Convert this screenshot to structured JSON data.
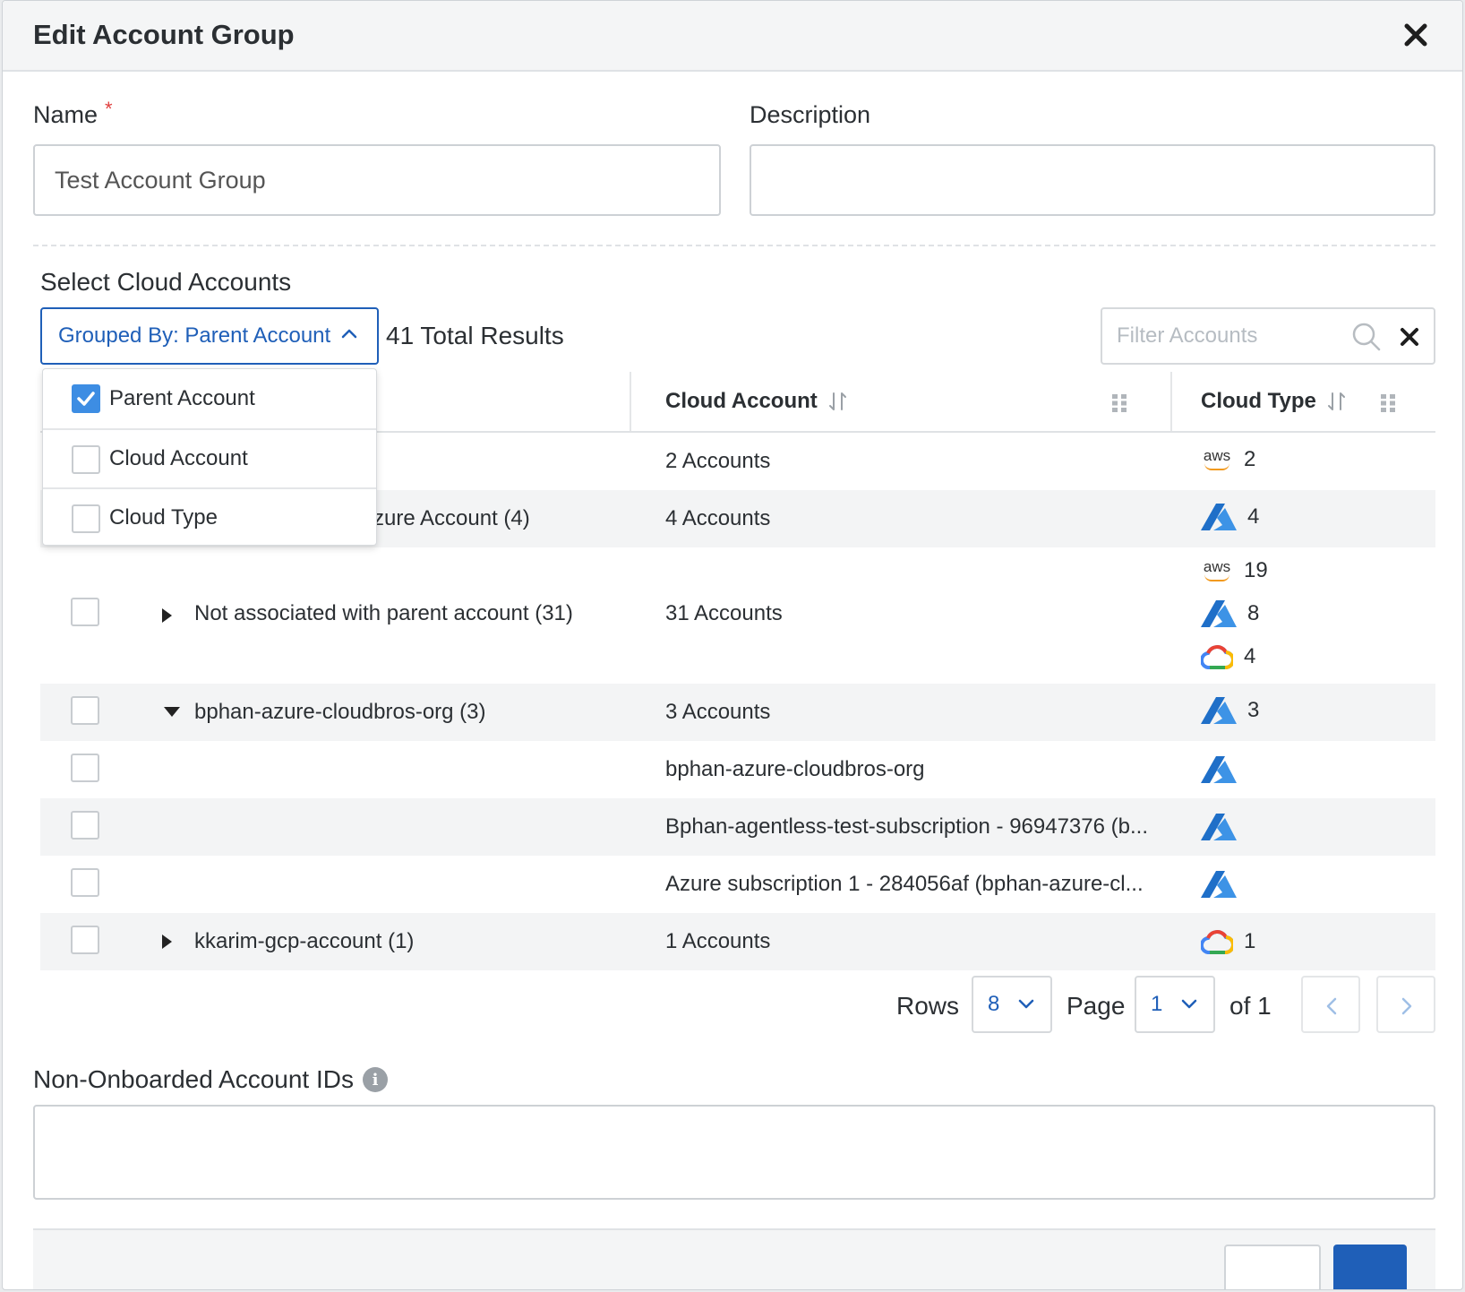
{
  "dialog": {
    "title": "Edit Account Group"
  },
  "form": {
    "name_label": "Name",
    "required_mark": "*",
    "name_value": "Test Account Group",
    "description_label": "Description",
    "description_value": ""
  },
  "cloud_accounts": {
    "section_title": "Select Cloud Accounts",
    "group_by_label": "Grouped By: Parent Account",
    "total_results": "41 Total Results",
    "filter_placeholder": "Filter Accounts"
  },
  "group_by_options": [
    {
      "label": "Parent Account",
      "checked": true
    },
    {
      "label": "Cloud Account",
      "checked": false
    },
    {
      "label": "Cloud Type",
      "checked": false
    }
  ],
  "table": {
    "columns": [
      "Cloud Account",
      "Cloud Type"
    ],
    "rows": [
      {
        "name": "",
        "accounts": "2 Accounts",
        "types": [
          {
            "icon": "aws-logo",
            "count": "2"
          }
        ]
      },
      {
        "name": "zure Account (4)",
        "accounts": "4 Accounts",
        "types": [
          {
            "icon": "azure-logo",
            "count": "4"
          }
        ]
      },
      {
        "name": "Not associated with parent account (31)",
        "accounts": "31 Accounts",
        "types": [
          {
            "icon": "aws-logo",
            "count": "19"
          },
          {
            "icon": "azure-logo",
            "count": "8"
          },
          {
            "icon": "gcp-logo",
            "count": "4"
          }
        ]
      },
      {
        "name": "bphan-azure-cloudbros-org (3)",
        "accounts": "3 Accounts",
        "types": [
          {
            "icon": "azure-logo",
            "count": "3"
          }
        ]
      },
      {
        "name": "",
        "accounts": "bphan-azure-cloudbros-org",
        "types": [
          {
            "icon": "azure-logo",
            "count": ""
          }
        ]
      },
      {
        "name": "",
        "accounts": "Bphan-agentless-test-subscription - 96947376 (b...",
        "types": [
          {
            "icon": "azure-logo",
            "count": ""
          }
        ]
      },
      {
        "name": "",
        "accounts": "Azure subscription 1 - 284056af (bphan-azure-cl...",
        "types": [
          {
            "icon": "azure-logo",
            "count": ""
          }
        ]
      },
      {
        "name": "kkarim-gcp-account (1)",
        "accounts": "1 Accounts",
        "types": [
          {
            "icon": "gcp-logo",
            "count": "1"
          }
        ]
      }
    ]
  },
  "pagination": {
    "rows_label": "Rows",
    "rows_value": "8",
    "page_label": "Page",
    "page_value": "1",
    "of_label": "of 1"
  },
  "non_onboarded": {
    "label": "Non-Onboarded Account IDs",
    "info_icon": "info-icon",
    "value": ""
  },
  "aws_text": "aws",
  "colors": {
    "accent": "#1f5fb8",
    "checkbox_checked": "#3d8de3",
    "required": "#e0403f",
    "azure": "#2f7fd6"
  }
}
